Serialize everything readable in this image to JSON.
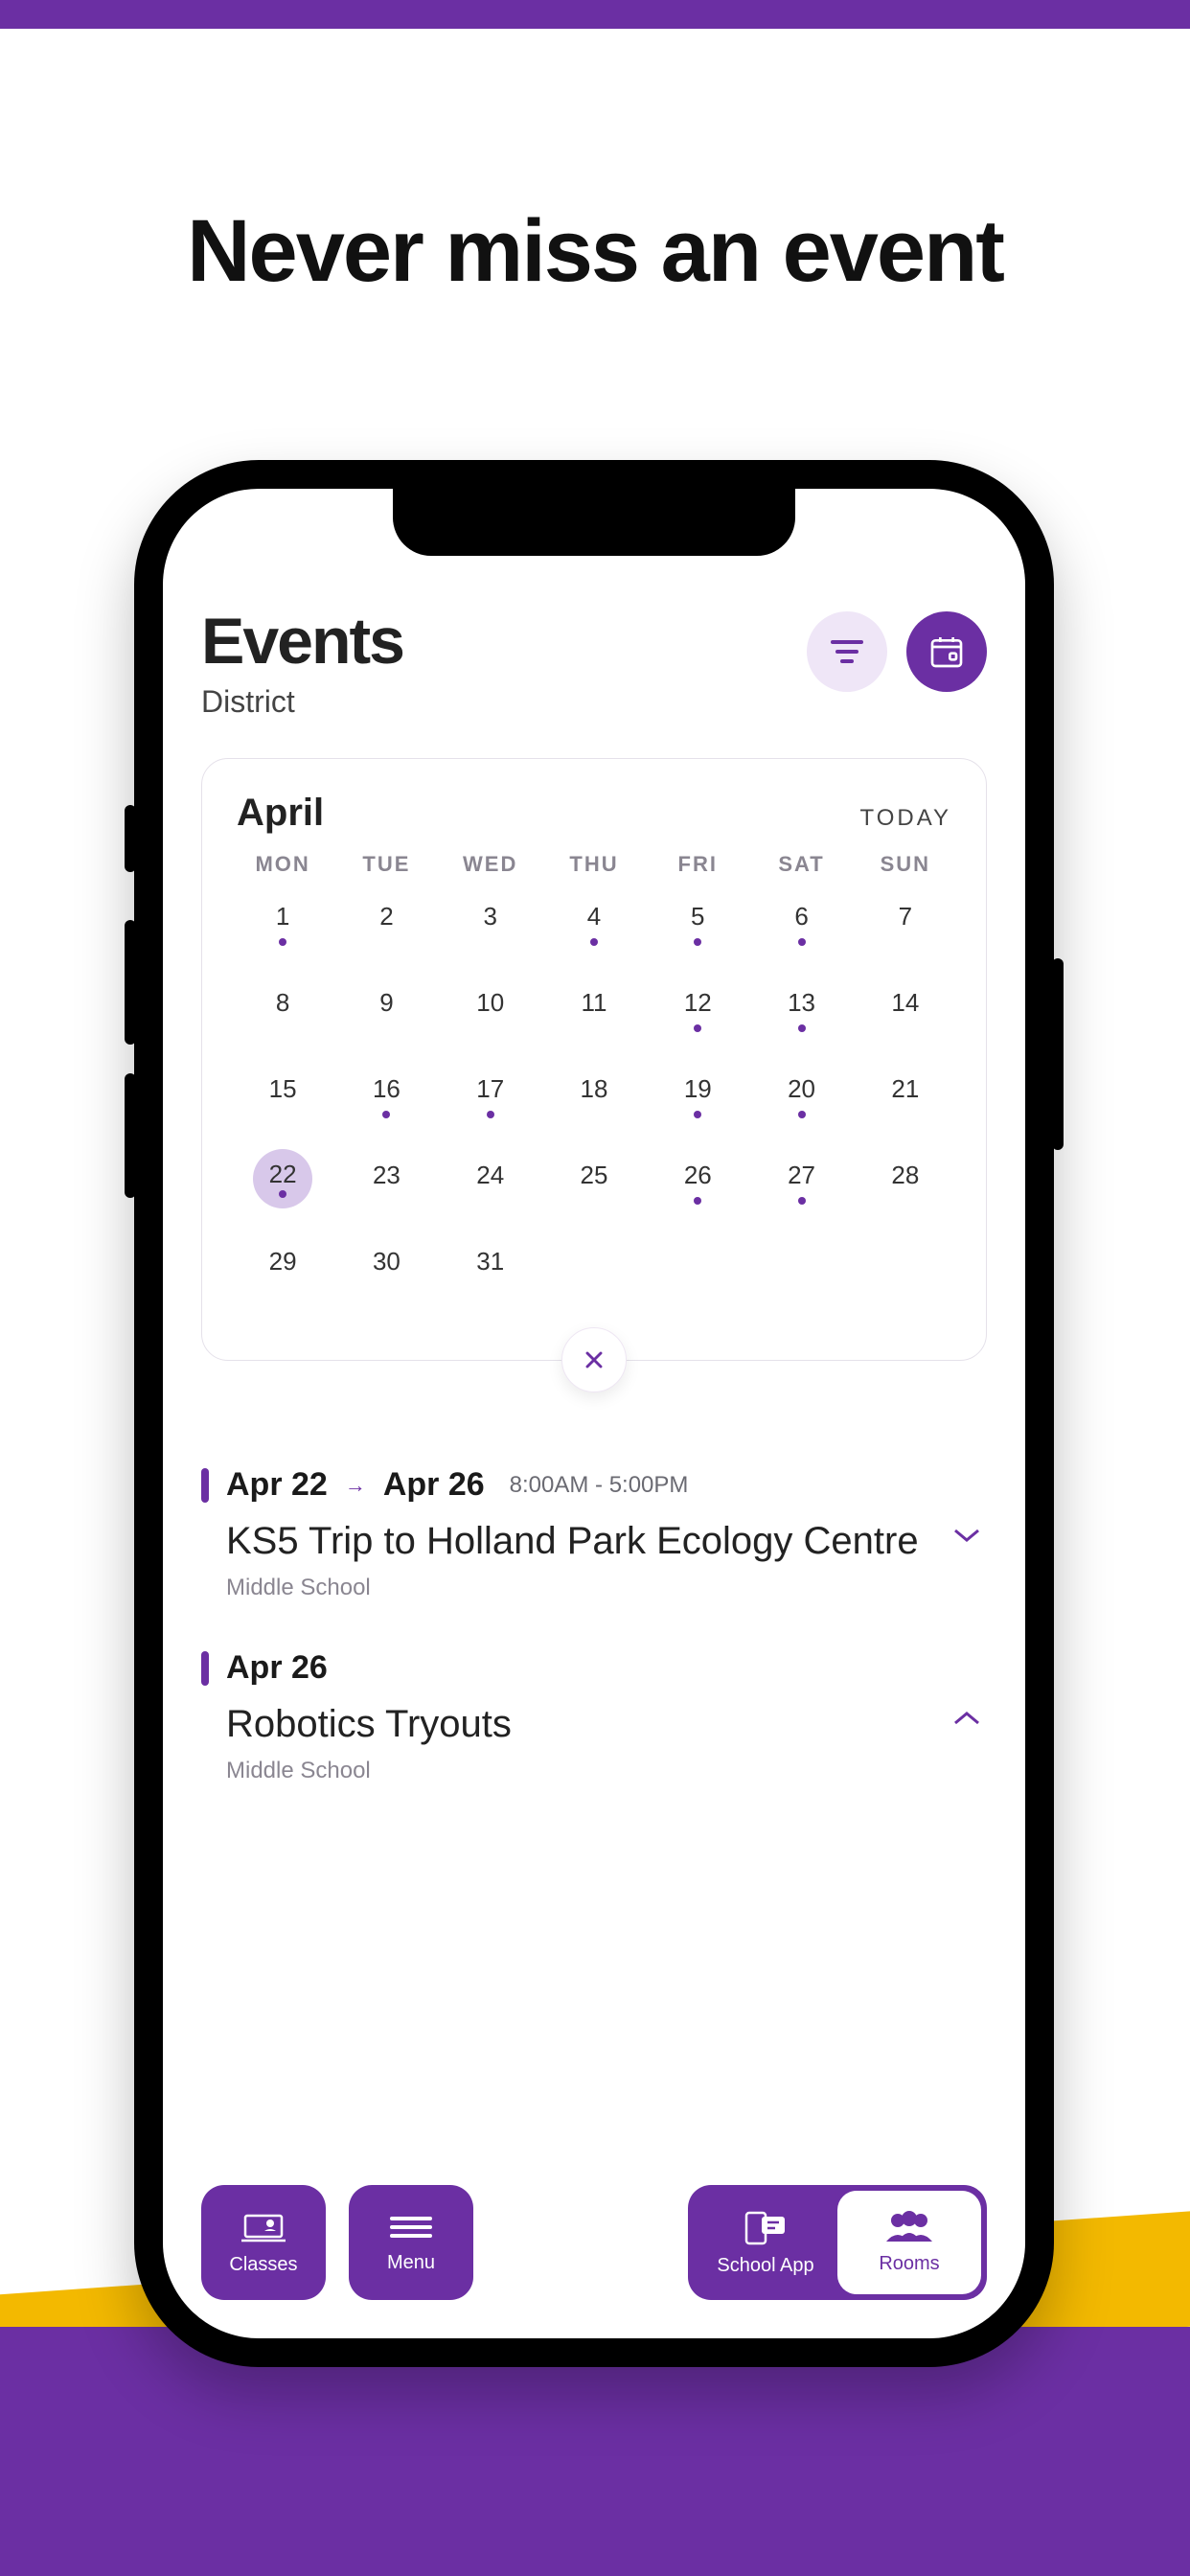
{
  "headline": "Never miss an event",
  "colors": {
    "accent": "#6b2fa3",
    "gold": "#f3b900"
  },
  "header": {
    "title": "Events",
    "subtitle": "District",
    "filter_icon": "filter-icon",
    "calendar_icon": "calendar-icon"
  },
  "calendar": {
    "month": "April",
    "today_label": "TODAY",
    "dow": [
      "MON",
      "TUE",
      "WED",
      "THU",
      "FRI",
      "SAT",
      "SUN"
    ],
    "days": [
      {
        "n": 1,
        "dot": true
      },
      {
        "n": 2
      },
      {
        "n": 3
      },
      {
        "n": 4,
        "dot": true
      },
      {
        "n": 5,
        "dot": true
      },
      {
        "n": 6,
        "dot": true
      },
      {
        "n": 7
      },
      {
        "n": 8
      },
      {
        "n": 9
      },
      {
        "n": 10
      },
      {
        "n": 11
      },
      {
        "n": 12,
        "dot": true
      },
      {
        "n": 13,
        "dot": true
      },
      {
        "n": 14
      },
      {
        "n": 15
      },
      {
        "n": 16,
        "dot": true
      },
      {
        "n": 17,
        "dot": true
      },
      {
        "n": 18
      },
      {
        "n": 19,
        "dot": true
      },
      {
        "n": 20,
        "dot": true
      },
      {
        "n": 21
      },
      {
        "n": 22,
        "dot": true,
        "sel": true
      },
      {
        "n": 23
      },
      {
        "n": 24
      },
      {
        "n": 25
      },
      {
        "n": 26,
        "dot": true
      },
      {
        "n": 27,
        "dot": true
      },
      {
        "n": 28
      },
      {
        "n": 29
      },
      {
        "n": 30
      },
      {
        "n": 31
      }
    ],
    "close_icon": "close-icon"
  },
  "events": [
    {
      "date_start": "Apr 22",
      "date_end": "Apr 26",
      "time_start": "8:00AM",
      "time_end": "5:00PM",
      "title": "KS5 Trip to Holland Park Ecology Centre",
      "location": "Middle School",
      "expanded": false
    },
    {
      "date_start": "Apr 26",
      "title": "Robotics Tryouts",
      "location": "Middle School",
      "expanded": true
    }
  ],
  "bottombar": {
    "left": [
      {
        "id": "classes",
        "label": "Classes"
      },
      {
        "id": "menu",
        "label": "Menu"
      }
    ],
    "right": [
      {
        "id": "schoolapp",
        "label": "School App",
        "active": false
      },
      {
        "id": "rooms",
        "label": "Rooms",
        "active": true
      }
    ]
  }
}
